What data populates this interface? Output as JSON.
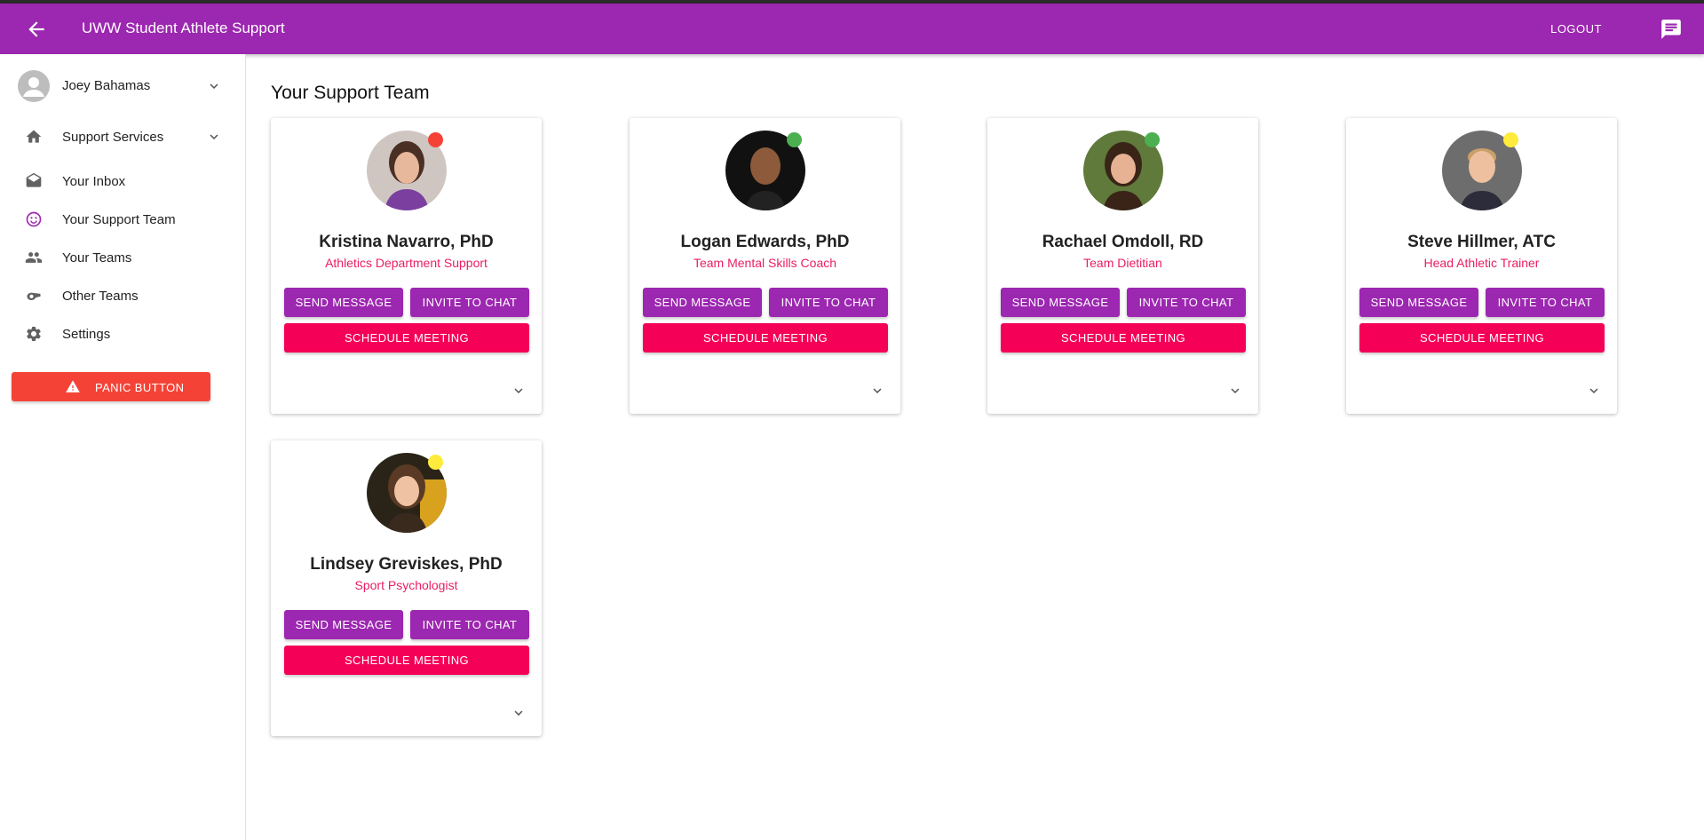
{
  "appbar": {
    "title": "UWW Student Athlete Support",
    "logout_label": "LOGOUT",
    "back_icon": "arrow-back-icon",
    "chat_icon": "chat-icon"
  },
  "sidebar": {
    "user_name": "Joey Bahamas",
    "items": [
      {
        "label": "Support Services",
        "icon": "home-icon"
      },
      {
        "label": "Your Inbox",
        "icon": "inbox-icon"
      },
      {
        "label": "Your Support Team",
        "icon": "smiley-icon"
      },
      {
        "label": "Your Teams",
        "icon": "people-icon"
      },
      {
        "label": "Other Teams",
        "icon": "whistle-icon"
      },
      {
        "label": "Settings",
        "icon": "gear-icon"
      }
    ],
    "panic_label": "PANIC BUTTON"
  },
  "main": {
    "title": "Your Support Team",
    "button_labels": {
      "send": "SEND MESSAGE",
      "invite": "INVITE TO CHAT",
      "schedule": "SCHEDULE MEETING"
    },
    "members": [
      {
        "name": "Kristina Navarro, PhD",
        "role": "Athletics Department Support",
        "status_color": "#f44336"
      },
      {
        "name": "Logan Edwards, PhD",
        "role": "Team Mental Skills Coach",
        "status_color": "#4caf50"
      },
      {
        "name": "Rachael Omdoll, RD",
        "role": "Team Dietitian",
        "status_color": "#4caf50"
      },
      {
        "name": "Steve Hillmer, ATC",
        "role": "Head Athletic Trainer",
        "status_color": "#ffeb3b"
      },
      {
        "name": "Lindsey Greviskes, PhD",
        "role": "Sport Psychologist",
        "status_color": "#ffeb3b"
      }
    ]
  },
  "colors": {
    "primary": "#9c27b0",
    "accent": "#f50057",
    "danger": "#f44336"
  }
}
